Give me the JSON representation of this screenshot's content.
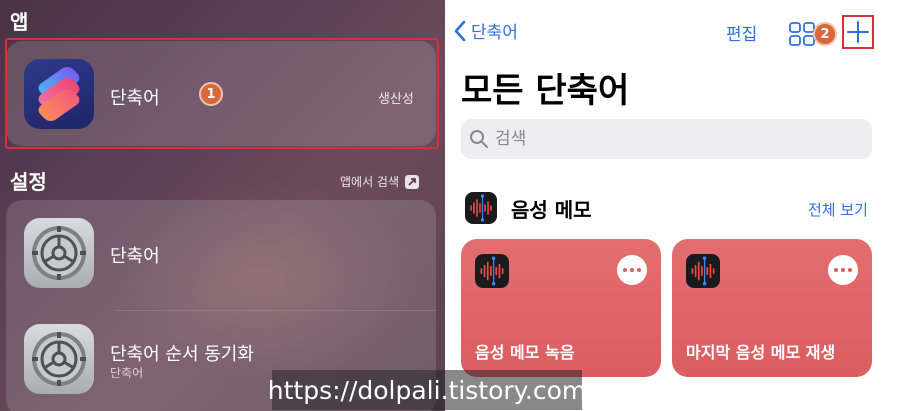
{
  "left": {
    "apps_section_title": "앱",
    "app_result": {
      "name": "단축어",
      "category": "생산성",
      "badge": "1"
    },
    "settings_section_title": "설정",
    "search_in_app": "앱에서 검색",
    "settings_results": [
      {
        "name": "단축어",
        "sub": ""
      },
      {
        "name": "단축어 순서 동기화",
        "sub": "단축어"
      }
    ]
  },
  "right": {
    "back_label": "단축어",
    "edit_label": "편집",
    "badge": "2",
    "title": "모든 단축어",
    "search": {
      "placeholder": "검색",
      "value": ""
    },
    "section": {
      "name": "음성 메모",
      "see_all": "전체 보기"
    },
    "shortcuts": [
      {
        "label": "음성 메모 녹음"
      },
      {
        "label": "마지막 음성 메모 재생"
      }
    ]
  },
  "watermark": "https://dolpali.tistory.com",
  "colors": {
    "accent": "#2f6fe0",
    "highlight": "#d6303a",
    "badge": "#d9683a",
    "card": "#e0676a"
  },
  "icons": {
    "back": "chevron-left-icon",
    "grid": "grid-icon",
    "add": "plus-icon",
    "search": "search-icon",
    "more": "ellipsis-icon",
    "app": "shortcuts-app-icon",
    "settings": "settings-gear-icon",
    "voice_memo": "voice-memo-icon",
    "external": "arrow-up-right-icon"
  }
}
